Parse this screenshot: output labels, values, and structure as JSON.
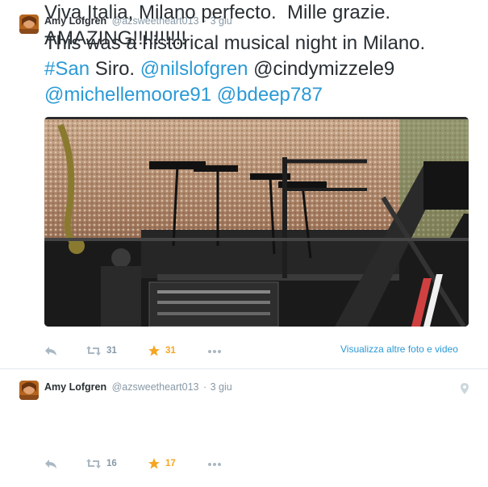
{
  "colors": {
    "link": "#2b9ad6",
    "muted": "#8899a6",
    "favorite": "#f5a623",
    "text": "#292f33",
    "border": "#e1e8ed"
  },
  "tweets": [
    {
      "fullname": "Amy Lofgren",
      "username": "@azsweetheart013",
      "separator": "·",
      "time": "3 giu",
      "text": {
        "line1": "This was a historical musical night in Milano.",
        "hashtag": "#San",
        "after_hashtag": " Siro. ",
        "mention1": "@nilslofgren",
        "between": " @cindymizzele9",
        "mention2": "@michellemoore91",
        "space": " ",
        "mention3": "@bdeep787"
      },
      "media_alt": "concert stage photo",
      "retweets": "31",
      "favorites": "31",
      "view_more": "Visualizza altre foto e video",
      "icons": [
        "reply-icon",
        "retweet-icon",
        "star-icon",
        "more-icon"
      ]
    },
    {
      "fullname": "Amy Lofgren",
      "username": "@azsweetheart013",
      "separator": "·",
      "time": "3 giu",
      "text": {
        "line1": "Viva Italia, Milano perfecto.  Mille grazie.",
        "line2": "AMAZING!!!!!!!!!!"
      },
      "retweets": "16",
      "favorites": "17",
      "icons": [
        "reply-icon",
        "retweet-icon",
        "star-icon",
        "more-icon",
        "location-pin-icon"
      ]
    }
  ]
}
